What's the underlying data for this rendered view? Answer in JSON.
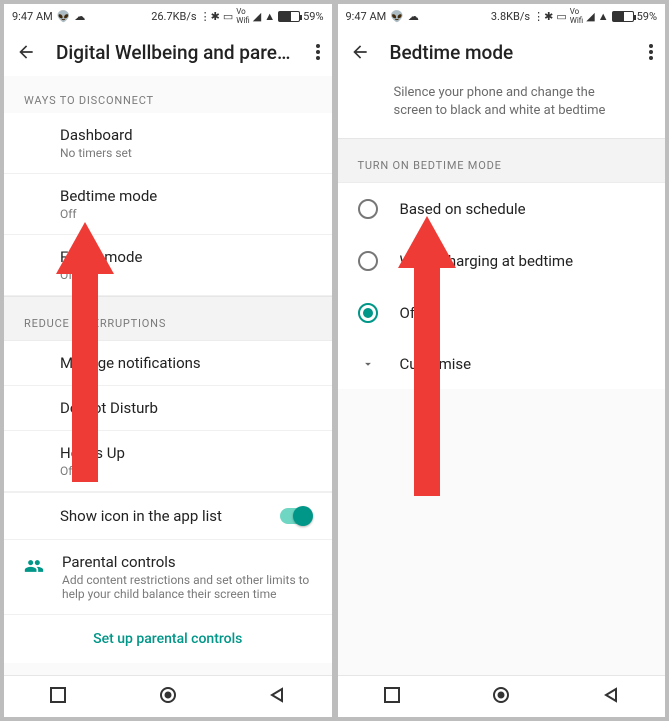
{
  "status": {
    "time": "9:47 AM",
    "net_left": "26.7KB/s",
    "net_right": "3.8KB/s",
    "battery_pct": "59%"
  },
  "left": {
    "title": "Digital Wellbeing and paren…",
    "sec1": "WAYS TO DISCONNECT",
    "dash": {
      "t": "Dashboard",
      "s": "No timers set"
    },
    "bed": {
      "t": "Bedtime mode",
      "s": "Off"
    },
    "focus": {
      "t": "Focus mode",
      "s": "Off"
    },
    "sec2": "REDUCE INTERRUPTIONS",
    "notif": "Manage notifications",
    "dnd": "Do Not Disturb",
    "heads": {
      "t": "Heads Up",
      "s": "Off"
    },
    "toggle": "Show icon in the app list",
    "parental": {
      "t": "Parental controls",
      "s": "Add content restrictions and set other limits to help your child balance their screen time"
    },
    "setup": "Set up parental controls"
  },
  "right": {
    "title": "Bedtime mode",
    "subtitle": "Silence your phone and change the screen to black and white at bedtime",
    "sec": "TURN ON BEDTIME MODE",
    "opt1": "Based on schedule",
    "opt2": "While charging at bedtime",
    "opt3": "Off",
    "custom": "Customise"
  }
}
